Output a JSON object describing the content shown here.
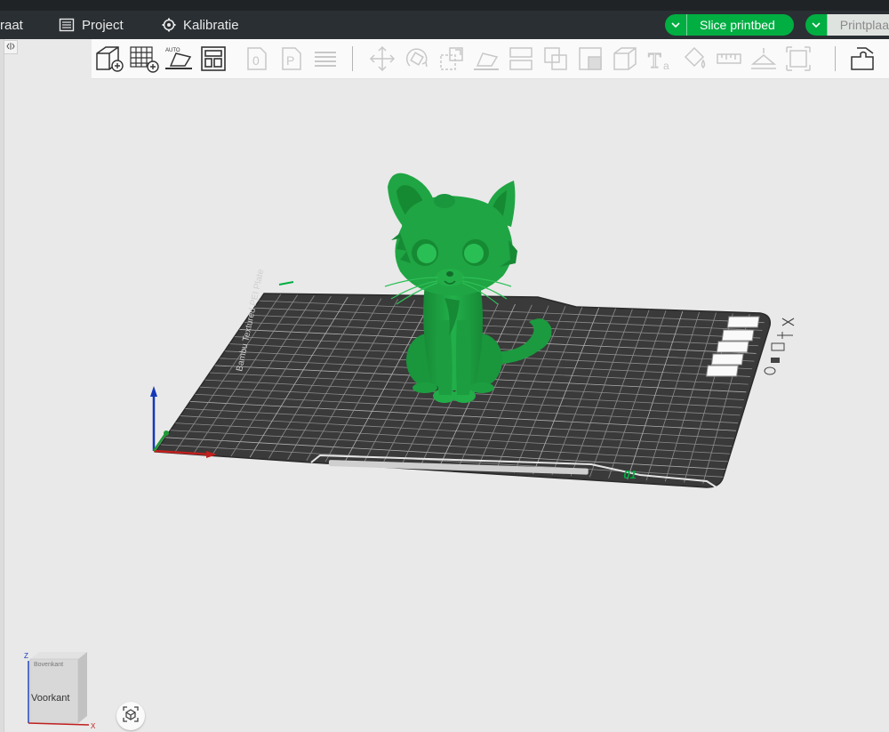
{
  "menubar": {
    "prepare_label": "raat",
    "project_label": "Project",
    "calibration_label": "Kalibratie",
    "slice_button_label": "Slice printbed",
    "print_button_label": "Printplaa"
  },
  "toolbar": {
    "tools": [
      "add-object",
      "add-plate",
      "auto-orient",
      "arrange",
      "split-objects",
      "split-parts",
      "layers",
      "move",
      "rotate",
      "scale",
      "lay-on-face",
      "cut",
      "boolean",
      "cut-connector",
      "mesh-boolean",
      "support-paint",
      "text",
      "seam-paint",
      "measure",
      "assembly",
      "fit",
      "variable-height"
    ]
  },
  "plate": {
    "number_label": "01",
    "brand_text": "Bambu Textured PEI Plate"
  },
  "cube": {
    "top_label": "Bovenkant",
    "front_label": "Voorkant",
    "axis_z": "Z",
    "axis_x": "X"
  },
  "colors": {
    "accent": "#00ae42",
    "model": "#1fa543",
    "plate": "#3a3a3a",
    "background": "#e9e9e9"
  }
}
